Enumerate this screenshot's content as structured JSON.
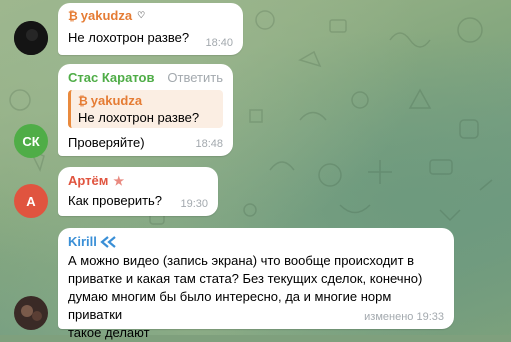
{
  "colors": {
    "accent_green": "#4fad47",
    "accent_orange": "#e57c34",
    "accent_red": "#e0543f",
    "accent_blue": "#3a8fd6",
    "time_gray": "#a3a9ae"
  },
  "messages": [
    {
      "author": "yakudza",
      "badge": "₿",
      "text": "Не лохотрон разве?",
      "time": "18:40"
    },
    {
      "author": "Стас Каратов",
      "action": "Ответить",
      "reply_author": "yakudza",
      "reply_badge": "₿",
      "reply_text": "Не лохотрон разве?",
      "text": "Проверяйте)",
      "time": "18:48",
      "avatar_initials": "СК"
    },
    {
      "author": "Артём",
      "badge_star": "★",
      "text": "Как проверить?",
      "time": "19:30",
      "avatar_initials": "А"
    },
    {
      "author": "Kirill",
      "text_lines": [
        "А можно видео (запись экрана) что вообще происходит в",
        "приватке и какая там стата? Без текущих сделок, конечно)",
        "думаю многим бы было интересно, да и многие норм приватки",
        "такое делают"
      ],
      "time": "изменено 19:33"
    }
  ]
}
